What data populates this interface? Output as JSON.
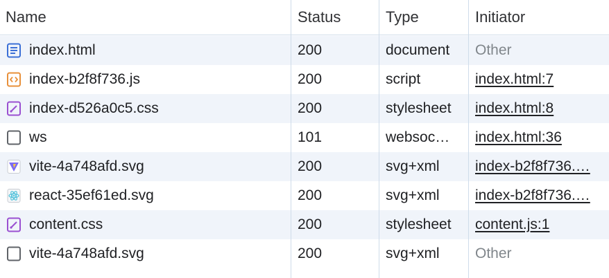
{
  "columns": {
    "name": "Name",
    "status": "Status",
    "type": "Type",
    "initiator": "Initiator"
  },
  "colors": {
    "document_icon": "#3b6fd6",
    "script_icon": "#e8903a",
    "stylesheet_icon": "#9a4fd1",
    "generic_icon": "#5f6368",
    "row_alt": "#f0f4fa",
    "grid": "#cfdcea"
  },
  "rows": [
    {
      "name": "index.html",
      "status": "200",
      "type": "document",
      "initiator": "Other",
      "initiator_link": false,
      "icon": "document-icon"
    },
    {
      "name": "index-b2f8f736.js",
      "status": "200",
      "type": "script",
      "initiator": "index.html:7",
      "initiator_link": true,
      "icon": "script-icon"
    },
    {
      "name": "index-d526a0c5.css",
      "status": "200",
      "type": "stylesheet",
      "initiator": "index.html:8",
      "initiator_link": true,
      "icon": "stylesheet-icon"
    },
    {
      "name": "ws",
      "status": "101",
      "type": "websoc…",
      "initiator": "index.html:36",
      "initiator_link": true,
      "icon": "websocket-icon"
    },
    {
      "name": "vite-4a748afd.svg",
      "status": "200",
      "type": "svg+xml",
      "initiator": "index-b2f8f736.…",
      "initiator_link": true,
      "icon": "vite-image-icon"
    },
    {
      "name": "react-35ef61ed.svg",
      "status": "200",
      "type": "svg+xml",
      "initiator": "index-b2f8f736.…",
      "initiator_link": true,
      "icon": "react-image-icon"
    },
    {
      "name": "content.css",
      "status": "200",
      "type": "stylesheet",
      "initiator": "content.js:1",
      "initiator_link": true,
      "icon": "stylesheet-icon"
    },
    {
      "name": "vite-4a748afd.svg",
      "status": "200",
      "type": "svg+xml",
      "initiator": "Other",
      "initiator_link": false,
      "icon": "generic-file-icon"
    }
  ]
}
